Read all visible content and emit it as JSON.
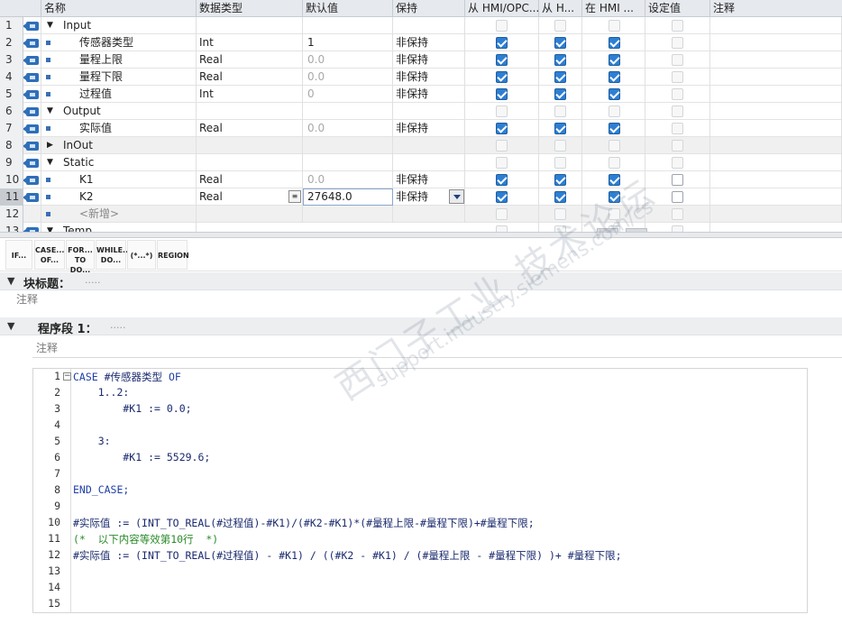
{
  "interface_table": {
    "columns": {
      "name": "名称",
      "datatype": "数据类型",
      "default": "默认值",
      "retain": "保持",
      "hmi_access": "从 HMI/OPC...",
      "hmi_write": "从 H...",
      "hmi_visible": "在 HMI ...",
      "setpoint": "设定值",
      "comment": "注释"
    },
    "rows": [
      {
        "num": "1",
        "name": "Input",
        "type": "",
        "default": "",
        "retain": ""
      },
      {
        "num": "2",
        "name": "传感器类型",
        "type": "Int",
        "default": "1",
        "retain": "非保持"
      },
      {
        "num": "3",
        "name": "量程上限",
        "type": "Real",
        "default": "0.0",
        "retain": "非保持"
      },
      {
        "num": "4",
        "name": "量程下限",
        "type": "Real",
        "default": "0.0",
        "retain": "非保持"
      },
      {
        "num": "5",
        "name": "过程值",
        "type": "Int",
        "default": "0",
        "retain": "非保持"
      },
      {
        "num": "6",
        "name": "Output",
        "type": "",
        "default": "",
        "retain": ""
      },
      {
        "num": "7",
        "name": "实际值",
        "type": "Real",
        "default": "0.0",
        "retain": "非保持"
      },
      {
        "num": "8",
        "name": "InOut",
        "type": "",
        "default": "",
        "retain": ""
      },
      {
        "num": "9",
        "name": "Static",
        "type": "",
        "default": "",
        "retain": ""
      },
      {
        "num": "10",
        "name": "K1",
        "type": "Real",
        "default": "0.0",
        "retain": "非保持"
      },
      {
        "num": "11",
        "name": "K2",
        "type": "Real",
        "default": "27648.0",
        "retain": "非保持"
      },
      {
        "num": "12",
        "name": "<新增>",
        "type": "",
        "default": "",
        "retain": ""
      },
      {
        "num": "13",
        "name": "Temp",
        "type": "",
        "default": "",
        "retain": ""
      }
    ]
  },
  "toolbar": {
    "if": "IF...",
    "case_1": "CASE...",
    "case_2": "OF...",
    "for_1": "FOR...",
    "for_2": "TO DO...",
    "while_1": "WHILE...",
    "while_2": "DO...",
    "comment": "(*...*)",
    "region": "REGION"
  },
  "block": {
    "title_label": "块标题：",
    "title_dots": ".....",
    "comment": "注释"
  },
  "network": {
    "title_label": "程序段 1：",
    "title_dots": ".....",
    "comment": "注释"
  },
  "code": {
    "line_numbers": [
      "1",
      "2",
      "3",
      "4",
      "5",
      "6",
      "7",
      "8",
      "9",
      "10",
      "11",
      "12",
      "13",
      "14",
      "15"
    ],
    "l1_kw1": "CASE",
    "l1_var": " #传感器类型 ",
    "l1_kw2": "OF",
    "l2": "    1..2:",
    "l3": "        #K1 := 0.0;",
    "l5": "    3:",
    "l6": "        #K1 := 5529.6;",
    "l8": "END_CASE;",
    "l10": "#实际值 := (INT_TO_REAL(#过程值)-#K1)/(#K2-#K1)*(#量程上限-#量程下限)+#量程下限;",
    "l11": "(*  以下内容等效第10行  *)",
    "l12": "#实际值 := (INT_TO_REAL(#过程值) - #K1) / ((#K2 - #K1) / (#量程上限 - #量程下限) )+ #量程下限;"
  },
  "watermark": {
    "line1": "西门子工业 技术论坛",
    "line2": "support.industry.siemens.com/cs"
  },
  "colors": {
    "checkbox_checked": "#2d7fd3",
    "keyword": "#1f3fa8",
    "comment_text": "#2a8a2a",
    "interface_icon": "#2f6fb8"
  }
}
